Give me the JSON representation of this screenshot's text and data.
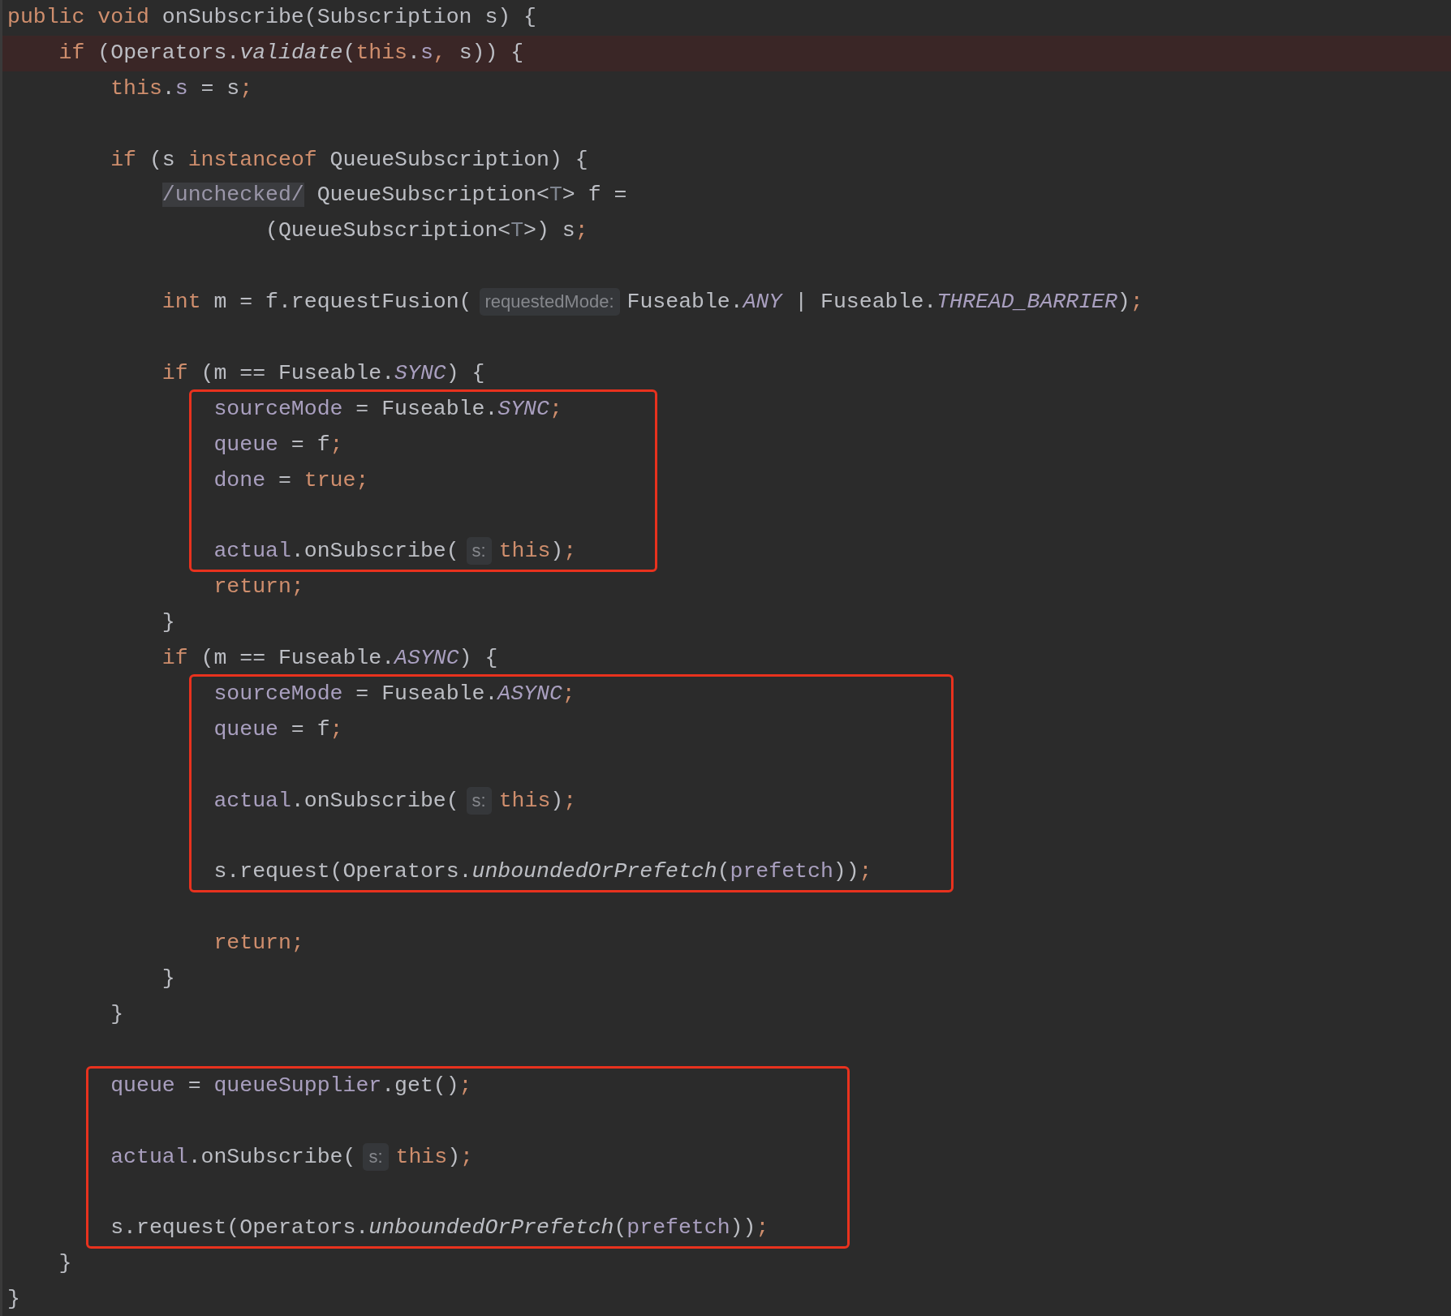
{
  "code": [
    {
      "kind": "line",
      "highlighted": false,
      "tokens": [
        {
          "text": "public void",
          "kind": "kw"
        },
        {
          "text": " onSubscribe(Subscription s) {",
          "kind": "plain"
        }
      ],
      "children": [
        {
          "kind": "line",
          "highlighted": true,
          "tokens": [
            {
              "text": "if",
              "kind": "kw"
            },
            {
              "text": " (Operators.",
              "kind": "plain"
            },
            {
              "text": "validate",
              "kind": "smethod"
            },
            {
              "text": "(",
              "kind": "plain"
            },
            {
              "text": "this",
              "kind": "kw"
            },
            {
              "text": ".",
              "kind": "plain"
            },
            {
              "text": "s",
              "kind": "field"
            },
            {
              "text": ",",
              "kind": "kw"
            },
            {
              "text": " s)) {",
              "kind": "plain"
            }
          ],
          "children": [
            {
              "kind": "line",
              "highlighted": false,
              "tokens": [
                {
                  "text": "this",
                  "kind": "kw"
                },
                {
                  "text": ".",
                  "kind": "plain"
                },
                {
                  "text": "s",
                  "kind": "field"
                },
                {
                  "text": " = s",
                  "kind": "plain"
                },
                {
                  "text": ";",
                  "kind": "kw"
                }
              ]
            },
            {
              "kind": "blank",
              "highlighted": false
            },
            {
              "kind": "line",
              "highlighted": false,
              "tokens": [
                {
                  "text": "if",
                  "kind": "kw"
                },
                {
                  "text": " (s ",
                  "kind": "plain"
                },
                {
                  "text": "instanceof",
                  "kind": "kw"
                },
                {
                  "text": " QueueSubscription) {",
                  "kind": "plain"
                }
              ],
              "children": [
                {
                  "kind": "line",
                  "highlighted": false,
                  "tokens": [
                    {
                      "text": "/unchecked/",
                      "kind": "folded"
                    },
                    {
                      "text": " QueueSubscription<",
                      "kind": "plain"
                    },
                    {
                      "text": "T",
                      "kind": "typeparam"
                    },
                    {
                      "text": "> f =",
                      "kind": "plain"
                    }
                  ],
                  "children": [
                    {
                      "kind": "continuation",
                      "highlighted": false,
                      "tokens": [
                        {
                          "text": "(QueueSubscription<",
                          "kind": "plain"
                        },
                        {
                          "text": "T",
                          "kind": "typeparam"
                        },
                        {
                          "text": ">) s",
                          "kind": "plain"
                        },
                        {
                          "text": ";",
                          "kind": "kw"
                        }
                      ]
                    }
                  ]
                },
                {
                  "kind": "blank",
                  "highlighted": false
                },
                {
                  "kind": "line",
                  "highlighted": false,
                  "tokens": [
                    {
                      "text": "int",
                      "kind": "kw"
                    },
                    {
                      "text": " m = f.requestFusion(",
                      "kind": "plain"
                    },
                    {
                      "text": "requestedMode:",
                      "kind": "hint"
                    },
                    {
                      "text": "Fuseable.",
                      "kind": "plain"
                    },
                    {
                      "text": "ANY",
                      "kind": "static"
                    },
                    {
                      "text": " | Fuseable.",
                      "kind": "plain"
                    },
                    {
                      "text": "THREAD_BARRIER",
                      "kind": "static"
                    },
                    {
                      "text": ")",
                      "kind": "plain"
                    },
                    {
                      "text": ";",
                      "kind": "kw"
                    }
                  ]
                },
                {
                  "kind": "blank",
                  "highlighted": false
                },
                {
                  "kind": "line",
                  "highlighted": false,
                  "tokens": [
                    {
                      "text": "if",
                      "kind": "kw"
                    },
                    {
                      "text": " (m == Fuseable.",
                      "kind": "plain"
                    },
                    {
                      "text": "SYNC",
                      "kind": "static"
                    },
                    {
                      "text": ") {",
                      "kind": "plain"
                    }
                  ],
                  "children": [
                    {
                      "kind": "frame",
                      "lines": [
                        {
                          "kind": "line",
                          "highlighted": false,
                          "tokens": [
                            {
                              "text": "sourceMode",
                              "kind": "field"
                            },
                            {
                              "text": " = Fuseable.",
                              "kind": "plain"
                            },
                            {
                              "text": "SYNC",
                              "kind": "static"
                            },
                            {
                              "text": ";",
                              "kind": "kw"
                            }
                          ]
                        },
                        {
                          "kind": "line",
                          "highlighted": false,
                          "tokens": [
                            {
                              "text": "queue",
                              "kind": "field"
                            },
                            {
                              "text": " = f",
                              "kind": "plain"
                            },
                            {
                              "text": ";",
                              "kind": "kw"
                            }
                          ]
                        },
                        {
                          "kind": "line",
                          "highlighted": false,
                          "tokens": [
                            {
                              "text": "done",
                              "kind": "field"
                            },
                            {
                              "text": " = ",
                              "kind": "plain"
                            },
                            {
                              "text": "true;",
                              "kind": "kw"
                            }
                          ]
                        },
                        {
                          "kind": "blank",
                          "highlighted": false
                        },
                        {
                          "kind": "line",
                          "highlighted": false,
                          "tokens": [
                            {
                              "text": "actual",
                              "kind": "field"
                            },
                            {
                              "text": ".onSubscribe(",
                              "kind": "plain"
                            },
                            {
                              "text": "s:",
                              "kind": "hint"
                            },
                            {
                              "text": "this",
                              "kind": "kw"
                            },
                            {
                              "text": ")",
                              "kind": "plain"
                            },
                            {
                              "text": ";",
                              "kind": "kw"
                            }
                          ]
                        }
                      ]
                    },
                    {
                      "kind": "line",
                      "highlighted": false,
                      "tokens": [
                        {
                          "text": "return;",
                          "kind": "kw"
                        }
                      ]
                    }
                  ]
                },
                {
                  "kind": "line",
                  "highlighted": false,
                  "tokens": [
                    {
                      "text": "}",
                      "kind": "plain"
                    }
                  ]
                },
                {
                  "kind": "line",
                  "highlighted": false,
                  "tokens": [
                    {
                      "text": "if",
                      "kind": "kw"
                    },
                    {
                      "text": " (m == Fuseable.",
                      "kind": "plain"
                    },
                    {
                      "text": "ASYNC",
                      "kind": "static"
                    },
                    {
                      "text": ") {",
                      "kind": "plain"
                    }
                  ],
                  "children": [
                    {
                      "kind": "frame",
                      "lines": [
                        {
                          "kind": "line",
                          "highlighted": false,
                          "tokens": [
                            {
                              "text": "sourceMode",
                              "kind": "field"
                            },
                            {
                              "text": " = Fuseable.",
                              "kind": "plain"
                            },
                            {
                              "text": "ASYNC",
                              "kind": "static"
                            },
                            {
                              "text": ";",
                              "kind": "kw"
                            }
                          ]
                        },
                        {
                          "kind": "line",
                          "highlighted": false,
                          "tokens": [
                            {
                              "text": "queue",
                              "kind": "field"
                            },
                            {
                              "text": " = f",
                              "kind": "plain"
                            },
                            {
                              "text": ";",
                              "kind": "kw"
                            }
                          ]
                        },
                        {
                          "kind": "blank",
                          "highlighted": false
                        },
                        {
                          "kind": "line",
                          "highlighted": false,
                          "tokens": [
                            {
                              "text": "actual",
                              "kind": "field"
                            },
                            {
                              "text": ".onSubscribe(",
                              "kind": "plain"
                            },
                            {
                              "text": "s:",
                              "kind": "hint"
                            },
                            {
                              "text": "this",
                              "kind": "kw"
                            },
                            {
                              "text": ")",
                              "kind": "plain"
                            },
                            {
                              "text": ";",
                              "kind": "kw"
                            }
                          ]
                        },
                        {
                          "kind": "blank",
                          "highlighted": false
                        },
                        {
                          "kind": "line",
                          "highlighted": false,
                          "tokens": [
                            {
                              "text": "s.request(Operators.",
                              "kind": "plain"
                            },
                            {
                              "text": "unboundedOrPrefetch",
                              "kind": "smethod"
                            },
                            {
                              "text": "(",
                              "kind": "plain"
                            },
                            {
                              "text": "prefetch",
                              "kind": "field"
                            },
                            {
                              "text": "))",
                              "kind": "plain"
                            },
                            {
                              "text": ";",
                              "kind": "kw"
                            }
                          ]
                        }
                      ]
                    },
                    {
                      "kind": "blank",
                      "highlighted": false
                    },
                    {
                      "kind": "line",
                      "highlighted": false,
                      "tokens": [
                        {
                          "text": "return;",
                          "kind": "kw"
                        }
                      ]
                    }
                  ]
                },
                {
                  "kind": "line",
                  "highlighted": false,
                  "tokens": [
                    {
                      "text": "}",
                      "kind": "plain"
                    }
                  ]
                }
              ]
            },
            {
              "kind": "line",
              "highlighted": false,
              "tokens": [
                {
                  "text": "}",
                  "kind": "plain"
                }
              ]
            },
            {
              "kind": "blank",
              "highlighted": false
            },
            {
              "kind": "frame",
              "lines": [
                {
                  "kind": "line",
                  "highlighted": false,
                  "tokens": [
                    {
                      "text": "queue",
                      "kind": "field"
                    },
                    {
                      "text": " = ",
                      "kind": "plain"
                    },
                    {
                      "text": "queueSupplier",
                      "kind": "field"
                    },
                    {
                      "text": ".get()",
                      "kind": "plain"
                    },
                    {
                      "text": ";",
                      "kind": "kw"
                    }
                  ]
                },
                {
                  "kind": "blank",
                  "highlighted": false
                },
                {
                  "kind": "line",
                  "highlighted": false,
                  "tokens": [
                    {
                      "text": "actual",
                      "kind": "field"
                    },
                    {
                      "text": ".onSubscribe(",
                      "kind": "plain"
                    },
                    {
                      "text": "s:",
                      "kind": "hint"
                    },
                    {
                      "text": "this",
                      "kind": "kw"
                    },
                    {
                      "text": ")",
                      "kind": "plain"
                    },
                    {
                      "text": ";",
                      "kind": "kw"
                    }
                  ]
                },
                {
                  "kind": "blank",
                  "highlighted": false
                },
                {
                  "kind": "line",
                  "highlighted": false,
                  "tokens": [
                    {
                      "text": "s.request(Operators.",
                      "kind": "plain"
                    },
                    {
                      "text": "unboundedOrPrefetch",
                      "kind": "smethod"
                    },
                    {
                      "text": "(",
                      "kind": "plain"
                    },
                    {
                      "text": "prefetch",
                      "kind": "field"
                    },
                    {
                      "text": "))",
                      "kind": "plain"
                    },
                    {
                      "text": ";",
                      "kind": "kw"
                    }
                  ]
                }
              ]
            }
          ]
        },
        {
          "kind": "line",
          "highlighted": false,
          "tokens": [
            {
              "text": "}",
              "kind": "plain"
            }
          ]
        }
      ]
    },
    {
      "kind": "line",
      "highlighted": false,
      "tokens": [
        {
          "text": "}",
          "kind": "plain"
        }
      ]
    }
  ]
}
